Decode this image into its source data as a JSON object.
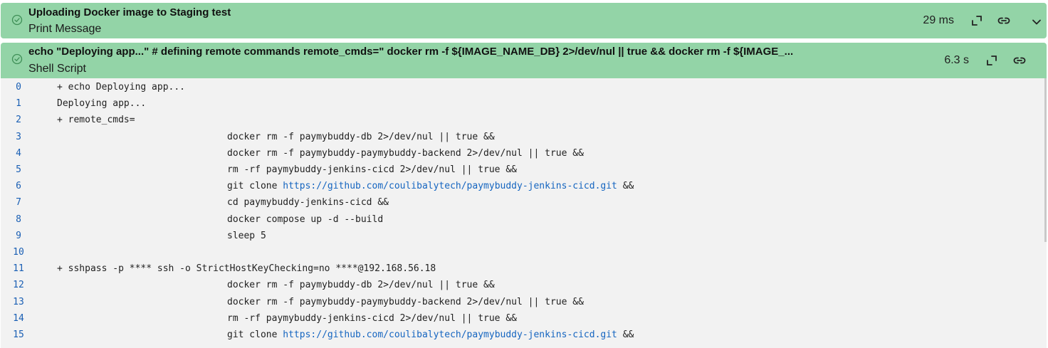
{
  "steps": [
    {
      "title": "Uploading Docker image to Staging test",
      "subtitle": "Print Message",
      "duration": "29 ms",
      "status": "success"
    },
    {
      "title": "echo \"Deploying app...\" # defining remote commands remote_cmds=\" docker rm -f ${IMAGE_NAME_DB} 2>/dev/nul || true && docker rm -f ${IMAGE_...",
      "subtitle": "Shell Script",
      "duration": "6.3 s",
      "status": "success"
    }
  ],
  "colors": {
    "step_success_bg": "#93d4a7",
    "log_bg": "#f2f2f2",
    "line_number": "#1a5fb4",
    "link": "#1565c0"
  },
  "icons": {
    "status": "check-circle-icon",
    "expand": "expand-icon",
    "link": "link-icon",
    "collapse": "chevron-down-icon"
  },
  "log": {
    "lines": [
      {
        "num": "0",
        "text": "+ echo Deploying app...",
        "indent": false
      },
      {
        "num": "1",
        "text": "Deploying app...",
        "indent": false
      },
      {
        "num": "2",
        "text": "+ remote_cmds=",
        "indent": false
      },
      {
        "num": "3",
        "text": "docker rm -f paymybuddy-db 2>/dev/nul || true &&",
        "indent": true
      },
      {
        "num": "4",
        "text": "docker rm -f paymybuddy-paymybuddy-backend 2>/dev/nul || true &&",
        "indent": true
      },
      {
        "num": "5",
        "text": "rm -rf paymybuddy-jenkins-cicd 2>/dev/nul || true &&",
        "indent": true
      },
      {
        "num": "6",
        "prefix": "git clone ",
        "url": "https://github.com/coulibalytech/paymybuddy-jenkins-cicd.git",
        "suffix": " &&",
        "indent": true
      },
      {
        "num": "7",
        "text": "cd paymybuddy-jenkins-cicd &&",
        "indent": true
      },
      {
        "num": "8",
        "text": "docker compose up -d --build",
        "indent": true
      },
      {
        "num": "9",
        "text": "sleep 5",
        "indent": true
      },
      {
        "num": "10",
        "text": "",
        "indent": false
      },
      {
        "num": "11",
        "text": "+ sshpass -p **** ssh -o StrictHostKeyChecking=no ****@192.168.56.18",
        "indent": false
      },
      {
        "num": "12",
        "text": "docker rm -f paymybuddy-db 2>/dev/nul || true &&",
        "indent": true
      },
      {
        "num": "13",
        "text": "docker rm -f paymybuddy-paymybuddy-backend 2>/dev/nul || true &&",
        "indent": true
      },
      {
        "num": "14",
        "text": "rm -rf paymybuddy-jenkins-cicd 2>/dev/nul || true &&",
        "indent": true
      },
      {
        "num": "15",
        "prefix": "git clone ",
        "url": "https://github.com/coulibalytech/paymybuddy-jenkins-cicd.git",
        "suffix": " &&",
        "indent": true
      }
    ]
  }
}
